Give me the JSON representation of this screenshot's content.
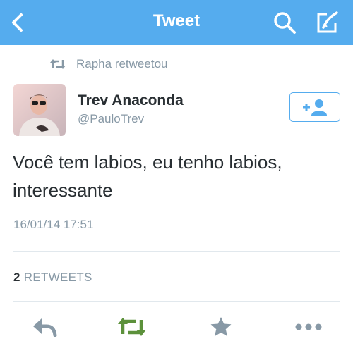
{
  "navbar": {
    "title": "Tweet",
    "background": "#55acee",
    "icons": {
      "back": "chevron-left-icon",
      "search": "search-icon",
      "compose": "compose-icon"
    }
  },
  "retweet_context": {
    "icon": "retweet-icon",
    "label": "Rapha retweetou"
  },
  "tweet": {
    "author_name": "Trev Anaconda",
    "author_handle": "@PauloTrev",
    "avatar_icon": "user-avatar",
    "follow_icon": "add-user-icon",
    "text_line1": "Você tem labios, eu tenho labios,",
    "text_line2": "interessante",
    "timestamp": "16/01/14 17:51"
  },
  "stats": {
    "retweet_count": "2",
    "retweet_label": "RETWEETS"
  },
  "actions": {
    "reply_icon": "reply-icon",
    "retweet_icon": "retweet-icon",
    "retweet_active_color": "#5c913b",
    "favorite_icon": "star-icon",
    "more_icon": "more-dots-icon",
    "inactive_color": "#8899a6"
  }
}
